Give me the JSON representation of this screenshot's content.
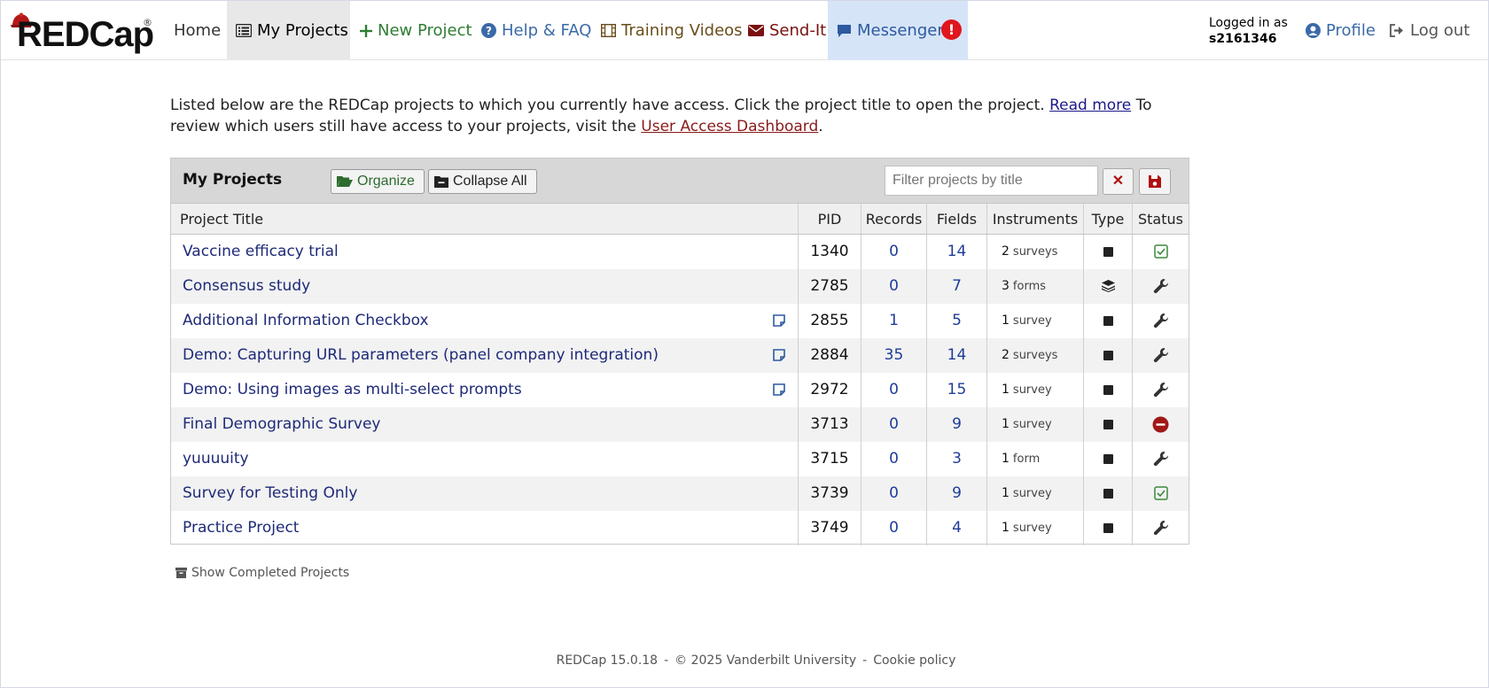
{
  "navbar": {
    "logo_text": "REDCap",
    "logo_mark": "®",
    "items": {
      "home": "Home",
      "my_projects": "My Projects",
      "new_project": "New Project",
      "help": "Help & FAQ",
      "training": "Training Videos",
      "send_it": "Send-It",
      "messenger": "Messenger"
    },
    "messenger_badge": "!",
    "logged_in_label": "Logged in as",
    "username": "s2161346",
    "profile": "Profile",
    "logout": "Log out"
  },
  "intro": {
    "text1": "Listed below are the REDCap projects to which you currently have access. Click the project title to open the project. ",
    "read_more": "Read more",
    "text2": " To review which users still have access to your projects, visit the ",
    "dashboard_link": "User Access Dashboard",
    "text3": "."
  },
  "projects_panel": {
    "title": "My Projects",
    "organize_label": "Organize",
    "collapse_label": "Collapse All",
    "filter_placeholder": "Filter projects by title",
    "clear_label": "✕",
    "columns": {
      "title": "Project Title",
      "pid": "PID",
      "records": "Records",
      "fields": "Fields",
      "instruments": "Instruments",
      "type": "Type",
      "status": "Status"
    },
    "rows": [
      {
        "title": "Vaccine efficacy trial",
        "pid": "1340",
        "records": "0",
        "fields": "14",
        "inst_count": "2",
        "inst_kind": "surveys",
        "type": "classic",
        "status": "production",
        "note": false
      },
      {
        "title": "Consensus study",
        "pid": "2785",
        "records": "0",
        "fields": "7",
        "inst_count": "3",
        "inst_kind": "forms",
        "type": "longitudinal",
        "status": "development",
        "note": false
      },
      {
        "title": "Additional Information Checkbox",
        "pid": "2855",
        "records": "1",
        "fields": "5",
        "inst_count": "1",
        "inst_kind": "survey",
        "type": "classic",
        "status": "development",
        "note": true
      },
      {
        "title": "Demo: Capturing URL parameters (panel company integration)",
        "pid": "2884",
        "records": "35",
        "fields": "14",
        "inst_count": "2",
        "inst_kind": "surveys",
        "type": "classic",
        "status": "development",
        "note": true
      },
      {
        "title": "Demo: Using images as multi-select prompts",
        "pid": "2972",
        "records": "0",
        "fields": "15",
        "inst_count": "1",
        "inst_kind": "survey",
        "type": "classic",
        "status": "development",
        "note": true
      },
      {
        "title": "Final Demographic Survey",
        "pid": "3713",
        "records": "0",
        "fields": "9",
        "inst_count": "1",
        "inst_kind": "survey",
        "type": "classic",
        "status": "inactive",
        "note": false
      },
      {
        "title": "yuuuuity",
        "pid": "3715",
        "records": "0",
        "fields": "3",
        "inst_count": "1",
        "inst_kind": "form",
        "type": "classic",
        "status": "development",
        "note": false
      },
      {
        "title": "Survey for Testing Only",
        "pid": "3739",
        "records": "0",
        "fields": "9",
        "inst_count": "1",
        "inst_kind": "survey",
        "type": "classic",
        "status": "production",
        "note": false
      },
      {
        "title": "Practice Project",
        "pid": "3749",
        "records": "0",
        "fields": "4",
        "inst_count": "1",
        "inst_kind": "survey",
        "type": "classic",
        "status": "development",
        "note": false
      }
    ]
  },
  "show_completed": "Show Completed Projects",
  "footer": {
    "version": "REDCap 15.0.18",
    "copyright": "© 2025 Vanderbilt University",
    "cookie": "Cookie policy",
    "separator": "-"
  },
  "colors": {
    "link": "#1e2a78",
    "new_project": "#2e7d32",
    "help": "#3b6aa8",
    "send_it": "#7a1010",
    "badge": "#e0151d",
    "production": "#3a8a3a",
    "inactive": "#a01818"
  }
}
